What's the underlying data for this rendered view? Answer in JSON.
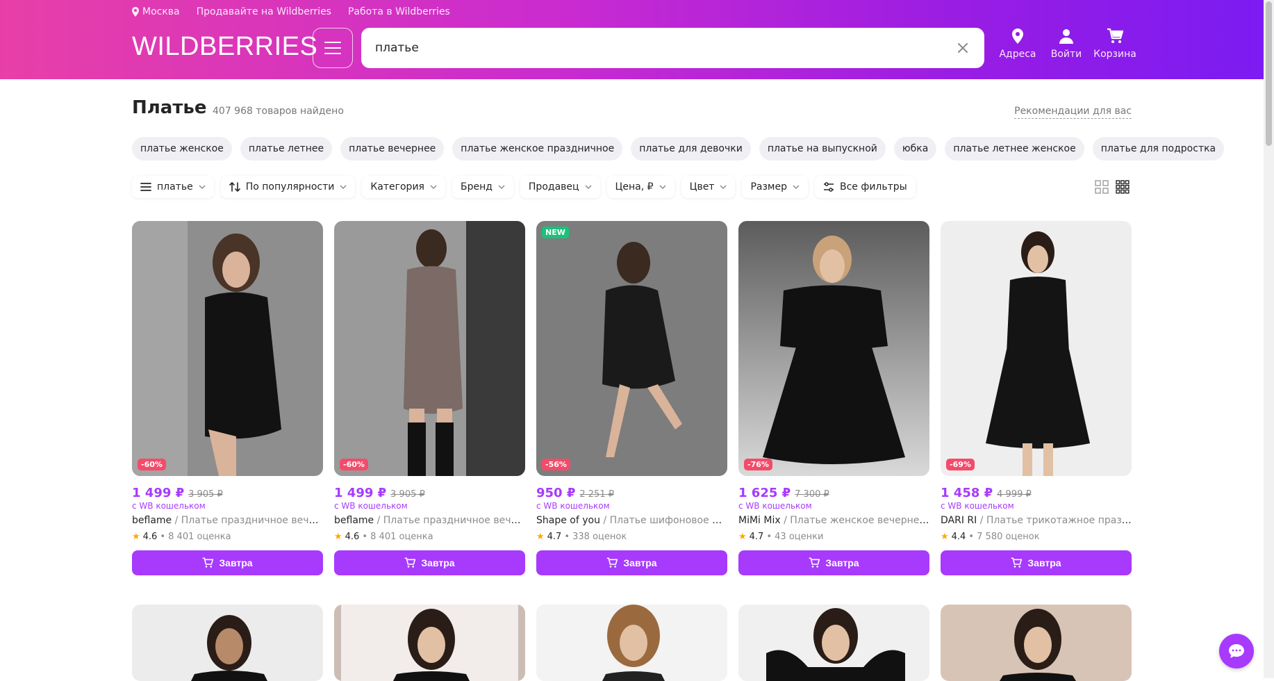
{
  "header": {
    "location": "Москва",
    "links": [
      "Продавайте на Wildberries",
      "Работа в Wildberries"
    ],
    "logo": "WILDBERRIES",
    "search_value": "платье",
    "icons": [
      {
        "label": "Адреса",
        "icon": "location-pin-icon"
      },
      {
        "label": "Войти",
        "icon": "user-icon"
      },
      {
        "label": "Корзина",
        "icon": "cart-icon"
      }
    ]
  },
  "page": {
    "title": "Платье",
    "count": "407 968 товаров найдено",
    "recommendations": "Рекомендации для вас"
  },
  "chips": [
    "платье женское",
    "платье летнее",
    "платье вечернее",
    "платье женское праздничное",
    "платье для девочки",
    "платье на выпускной",
    "юбка",
    "платье летнее женское",
    "платье для подростка"
  ],
  "filters": [
    {
      "label": "платье",
      "icon": "menu-lines-icon"
    },
    {
      "label": "По популярности",
      "icon": "sort-arrows-icon"
    },
    {
      "label": "Категория"
    },
    {
      "label": "Бренд"
    },
    {
      "label": "Продавец"
    },
    {
      "label": "Цена, ₽"
    },
    {
      "label": "Цвет"
    },
    {
      "label": "Размер"
    },
    {
      "label": "Все фильтры",
      "icon": "filter-sliders-icon"
    }
  ],
  "products": [
    {
      "discount": "-60%",
      "price": "1 499 ₽",
      "old_price": "3 905 ₽",
      "wallet": "с WB кошельком",
      "brand": "beflame",
      "name": " / Платье праздничное вечернее",
      "rating": "4.6",
      "reviews": "• 8 401 оценка",
      "delivery": "Завтра"
    },
    {
      "discount": "-60%",
      "price": "1 499 ₽",
      "old_price": "3 905 ₽",
      "wallet": "с WB кошельком",
      "brand": "beflame",
      "name": " / Платье праздничное вечернее",
      "rating": "4.6",
      "reviews": "• 8 401 оценка",
      "delivery": "Завтра"
    },
    {
      "discount": "-56%",
      "is_new": "NEW",
      "price": "950 ₽",
      "old_price": "2 251 ₽",
      "wallet": "с WB кошельком",
      "brand": "Shape of you",
      "name": " / Платье шифоновое в горошек",
      "rating": "4.7",
      "reviews": "• 338 оценок",
      "delivery": "Завтра"
    },
    {
      "discount": "-76%",
      "price": "1 625 ₽",
      "old_price": "7 300 ₽",
      "wallet": "с WB кошельком",
      "brand": "MiMi Mix",
      "name": " / Платье женское вечернее праздничное",
      "rating": "4.7",
      "reviews": "• 43 оценки",
      "delivery": "Завтра"
    },
    {
      "discount": "-69%",
      "price": "1 458 ₽",
      "old_price": "4 999 ₽",
      "wallet": "с WB кошельком",
      "brand": "DARI RI",
      "name": " / Платье трикотажное праздничное",
      "rating": "4.4",
      "reviews": "• 7 580 оценок",
      "delivery": "Завтра"
    }
  ],
  "colors": {
    "accent": "#a73afd",
    "discount": "#f44b6a",
    "new": "#19c27a",
    "star": "#ffa800"
  }
}
